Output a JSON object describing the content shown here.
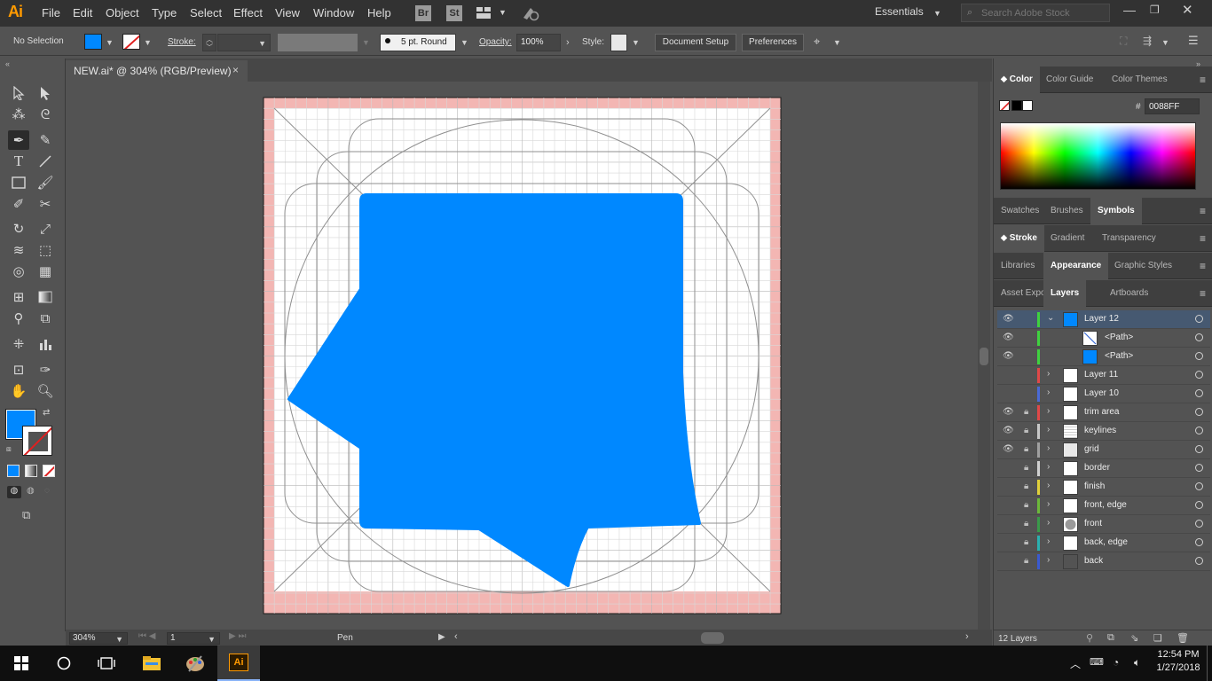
{
  "app": {
    "logo": "Ai"
  },
  "menu": [
    "File",
    "Edit",
    "Object",
    "Type",
    "Select",
    "Effect",
    "View",
    "Window",
    "Help"
  ],
  "bridge_badges": [
    "Br",
    "St"
  ],
  "workspace": {
    "label": "Essentials"
  },
  "search": {
    "placeholder": "Search Adobe Stock"
  },
  "control_bar": {
    "selection": "No Selection",
    "stroke_label": "Stroke:",
    "brush": "5 pt. Round",
    "opacity_label": "Opacity:",
    "opacity_value": "100%",
    "style_label": "Style:",
    "document_setup": "Document Setup",
    "preferences": "Preferences"
  },
  "document_tab": {
    "title": "NEW.ai* @ 304% (RGB/Preview)",
    "close": "×"
  },
  "tools": [
    "selection-tool",
    "direct-selection-tool",
    "magic-wand-tool",
    "lasso-tool",
    "pen-tool",
    "curvature-tool",
    "type-tool",
    "line-tool",
    "rectangle-tool",
    "paintbrush-tool",
    "shaper-tool",
    "scissors-tool",
    "rotate-tool",
    "scale-tool",
    "width-tool",
    "free-transform-tool",
    "shape-builder-tool",
    "perspective-grid-tool",
    "mesh-tool",
    "gradient-tool",
    "eyedropper-tool",
    "blend-tool",
    "symbol-sprayer-tool",
    "graph-tool",
    "artboard-tool",
    "slice-tool",
    "hand-tool",
    "zoom-tool"
  ],
  "colors": {
    "fill": "#0088FF",
    "artboard_bleed": "#f3b6b3",
    "grid": "#d4d4d4",
    "keyline": "#8f8f8f"
  },
  "panels": {
    "color_tabs": [
      "Color",
      "Color Guide",
      "Color Themes"
    ],
    "hex_label": "#",
    "hex_value": "0088FF",
    "swatch_tabs": [
      "Swatches",
      "Brushes",
      "Symbols"
    ],
    "stroke_tabs": [
      "Stroke",
      "Gradient",
      "Transparency"
    ],
    "library_tabs": [
      "Libraries",
      "Appearance",
      "Graphic Styles"
    ],
    "layer_tabs": [
      "Asset Export",
      "Layers",
      "Artboards"
    ],
    "layers_count": "12 Layers"
  },
  "layers": [
    {
      "name": "Layer 12",
      "color": "#3fd13f",
      "visible": true,
      "locked": false,
      "expanded": true,
      "selected": true,
      "indent": 0,
      "thumb": "blue"
    },
    {
      "name": "<Path>",
      "color": "#3fd13f",
      "visible": true,
      "locked": false,
      "expanded": false,
      "selected": false,
      "indent": 1,
      "thumb": "stroke"
    },
    {
      "name": "<Path>",
      "color": "#3fd13f",
      "visible": true,
      "locked": false,
      "expanded": false,
      "selected": false,
      "indent": 1,
      "thumb": "blue"
    },
    {
      "name": "Layer 11",
      "color": "#e04848",
      "visible": false,
      "locked": false,
      "expanded": false,
      "selected": false,
      "indent": 0,
      "thumb": "white"
    },
    {
      "name": "Layer 10",
      "color": "#4a6ad6",
      "visible": false,
      "locked": false,
      "expanded": false,
      "selected": false,
      "indent": 0,
      "thumb": "white"
    },
    {
      "name": "trim area",
      "color": "#e04848",
      "visible": true,
      "locked": true,
      "expanded": false,
      "selected": false,
      "indent": 0,
      "thumb": "white"
    },
    {
      "name": "keylines",
      "color": "#c8c8c8",
      "visible": true,
      "locked": true,
      "expanded": false,
      "selected": false,
      "indent": 0,
      "thumb": "grid"
    },
    {
      "name": "grid",
      "color": "#a0a0a0",
      "visible": true,
      "locked": true,
      "expanded": false,
      "selected": false,
      "indent": 0,
      "thumb": "light"
    },
    {
      "name": "border",
      "color": "#d0d0d0",
      "visible": false,
      "locked": true,
      "expanded": false,
      "selected": false,
      "indent": 0,
      "thumb": "white"
    },
    {
      "name": "finish",
      "color": "#e0d03a",
      "visible": false,
      "locked": true,
      "expanded": false,
      "selected": false,
      "indent": 0,
      "thumb": "white"
    },
    {
      "name": "front, edge",
      "color": "#6cb83a",
      "visible": false,
      "locked": true,
      "expanded": false,
      "selected": false,
      "indent": 0,
      "thumb": "white"
    },
    {
      "name": "front",
      "color": "#3a9a4a",
      "visible": false,
      "locked": true,
      "expanded": false,
      "selected": false,
      "indent": 0,
      "thumb": "circle"
    },
    {
      "name": "back, edge",
      "color": "#2ab0b0",
      "visible": false,
      "locked": true,
      "expanded": false,
      "selected": false,
      "indent": 0,
      "thumb": "white"
    },
    {
      "name": "back",
      "color": "#3a5ad0",
      "visible": false,
      "locked": true,
      "expanded": false,
      "selected": false,
      "indent": 0,
      "thumb": "dark"
    }
  ],
  "status": {
    "zoom": "304%",
    "artboard": "1",
    "tool": "Pen"
  },
  "taskbar": {
    "time": "12:54 PM",
    "date": "1/27/2018"
  }
}
